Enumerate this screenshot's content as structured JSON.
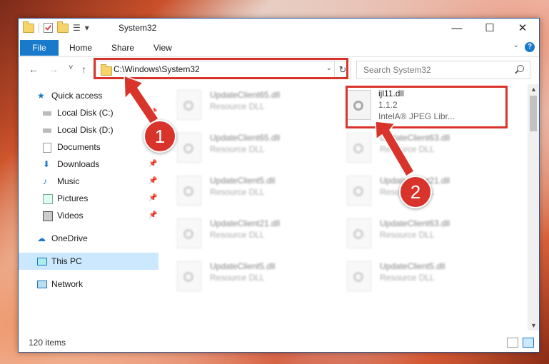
{
  "window": {
    "title": "System32",
    "help_label": "?"
  },
  "ribbon": {
    "tabs": [
      "File",
      "Home",
      "Share",
      "View"
    ]
  },
  "nav": {
    "back": "←",
    "forward": "→",
    "recent": "˅",
    "up": "↑"
  },
  "address": {
    "path": "C:\\Windows\\System32",
    "dropdown": "⌄",
    "refresh": "↻"
  },
  "search": {
    "placeholder": "Search System32"
  },
  "sidebar": {
    "items": [
      {
        "label": "Quick access"
      },
      {
        "label": "Local Disk (C:)"
      },
      {
        "label": "Local Disk (D:)"
      },
      {
        "label": "Documents"
      },
      {
        "label": "Downloads"
      },
      {
        "label": "Music"
      },
      {
        "label": "Pictures"
      },
      {
        "label": "Videos"
      },
      {
        "label": "OneDrive"
      },
      {
        "label": "This PC"
      },
      {
        "label": "Network"
      }
    ]
  },
  "files": [
    {
      "name": "UpdateClient65.dll",
      "desc": "Resource DLL"
    },
    {
      "name": "UpdateClient65.dll",
      "desc": "Resource DLL"
    },
    {
      "name": "UpdateClient5.dll",
      "desc": "Resource DLL"
    },
    {
      "name": "UpdateClient21.dll",
      "desc": "Resource DLL"
    },
    {
      "name": "UpdateClient5.dll",
      "desc": "Resource DLL"
    },
    {
      "name": "ijl11.dll",
      "version": "1.1.2",
      "desc": "IntelA® JPEG Libr..."
    },
    {
      "name": "UpdateClient63.dll",
      "desc": "Resource DLL"
    },
    {
      "name": "UpdateClient21.dll",
      "desc": "Resource DLL"
    },
    {
      "name": "UpdateClient63.dll",
      "desc": "Resource DLL"
    },
    {
      "name": "UpdateClient5.dll",
      "desc": "Resource DLL"
    }
  ],
  "status": {
    "count": "120 items"
  },
  "callouts": {
    "one": "1",
    "two": "2"
  },
  "colors": {
    "accent": "#1979ca",
    "callout": "#d9342b",
    "selected": "#cce8ff"
  }
}
